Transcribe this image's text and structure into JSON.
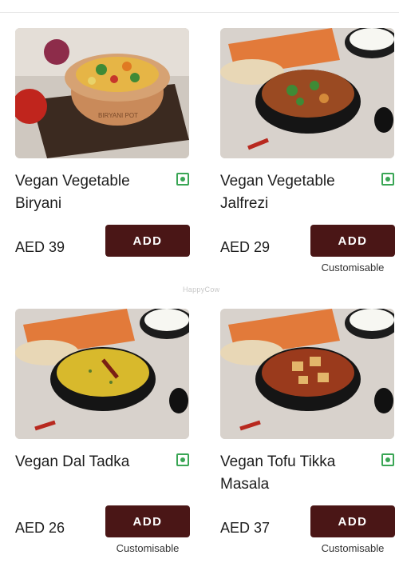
{
  "watermark": "HappyCow",
  "menu": {
    "items": [
      {
        "name": "Vegan Vegetable Biryani",
        "currency": "AED",
        "price": "39",
        "add_label": "ADD",
        "customisable": ""
      },
      {
        "name": "Vegan Vegetable Jalfrezi",
        "currency": "AED",
        "price": "29",
        "add_label": "ADD",
        "customisable": "Customisable"
      },
      {
        "name": "Vegan Dal Tadka",
        "currency": "AED",
        "price": "26",
        "add_label": "ADD",
        "customisable": "Customisable"
      },
      {
        "name": "Vegan Tofu Tikka Masala",
        "currency": "AED",
        "price": "37",
        "add_label": "ADD",
        "customisable": "Customisable"
      }
    ]
  },
  "colors": {
    "add_button": "#4a1616",
    "veg_indicator": "#3aa655"
  },
  "icons": [
    "veg-indicator-icon"
  ]
}
